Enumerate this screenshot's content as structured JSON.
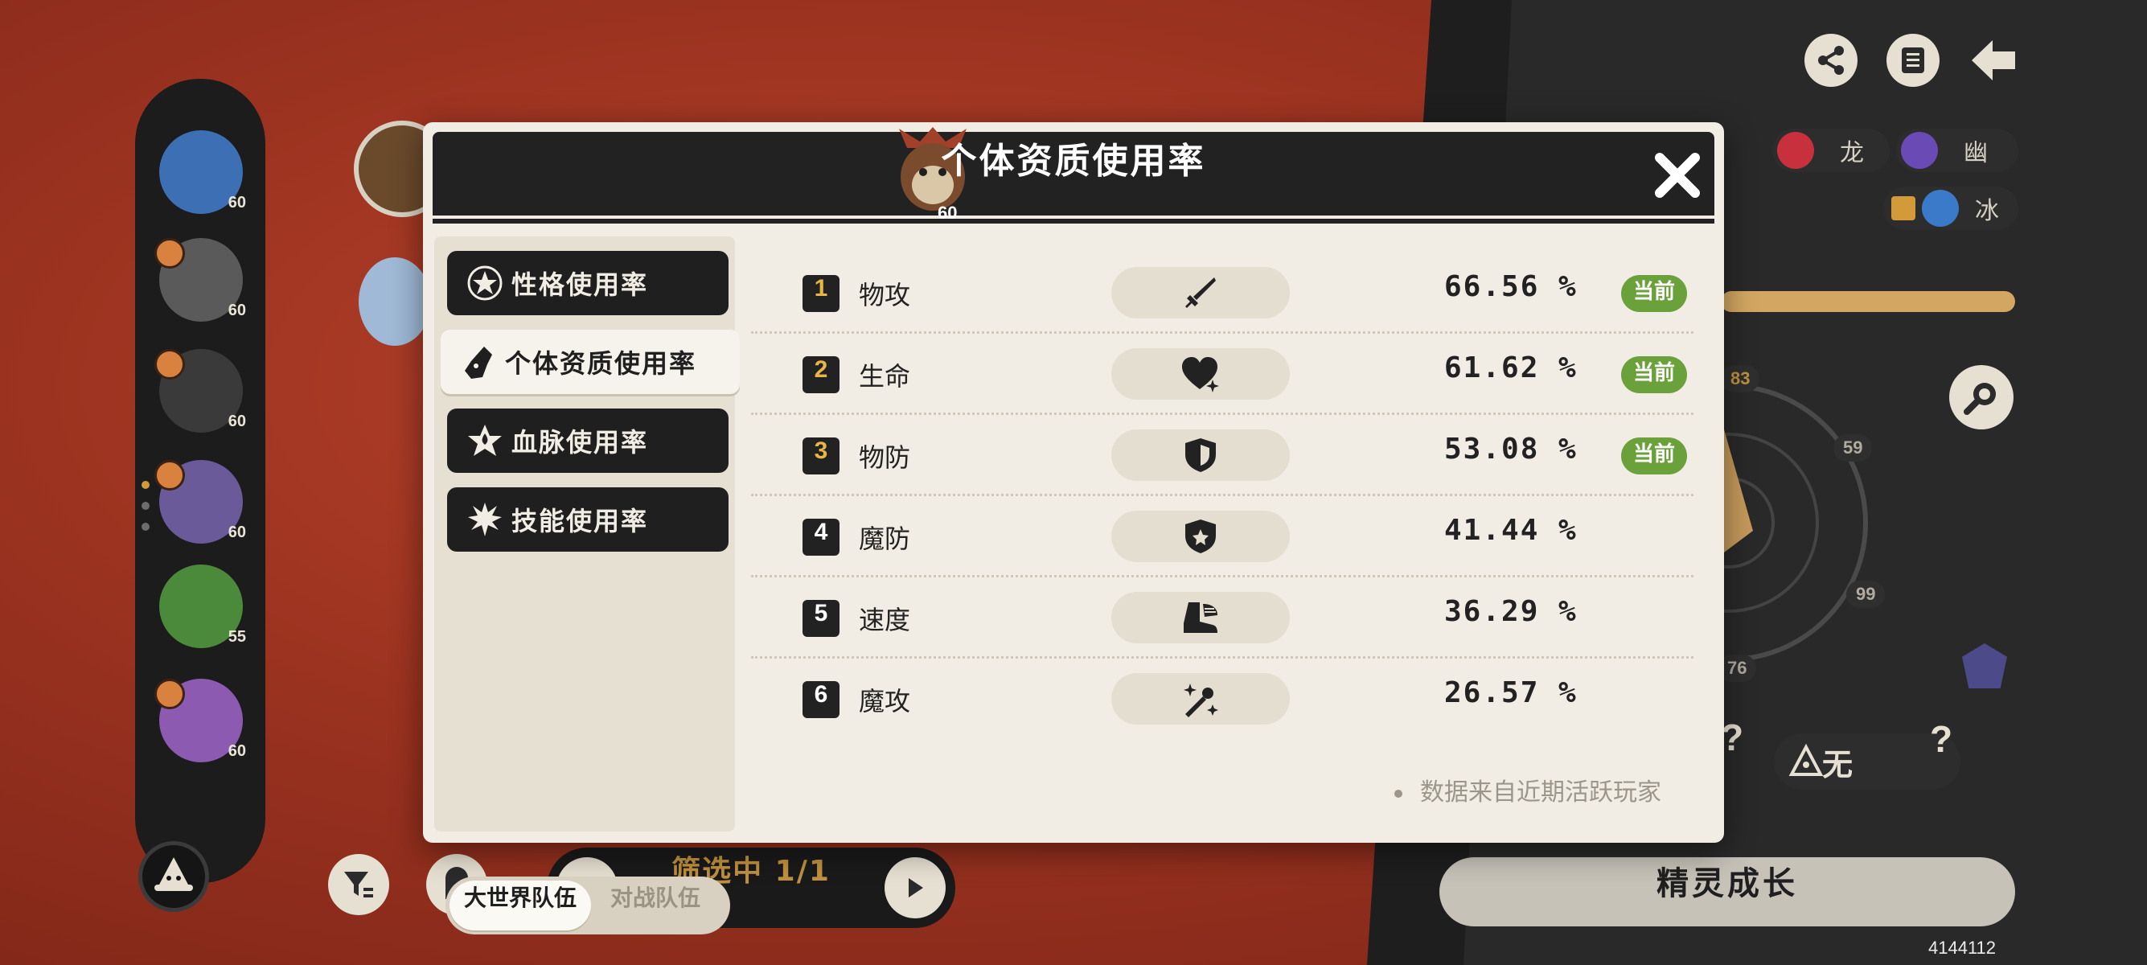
{
  "roster": [
    {
      "level": "60",
      "badge": false,
      "color": "#3d6fb5"
    },
    {
      "level": "60",
      "badge": true,
      "color": "#5a5a5a"
    },
    {
      "level": "60",
      "badge": true,
      "color": "#3a3a3a"
    },
    {
      "level": "60",
      "badge": true,
      "color": "#6a5a9a"
    },
    {
      "level": "55",
      "badge": false,
      "color": "#4b8a3a"
    },
    {
      "level": "60",
      "badge": true,
      "color": "#8c5ab0"
    }
  ],
  "filter": {
    "label": "筛选中 1/1"
  },
  "types": [
    {
      "label": "龙",
      "color": "#c8303e"
    },
    {
      "label": "幽",
      "color": "#6a4ab4"
    },
    {
      "label": "冰",
      "color": "#3a7ac8"
    }
  ],
  "radar": {
    "top_label": "83",
    "speed_label": "59",
    "def_label": "99",
    "bottom_label": "76"
  },
  "nature_chip": {
    "label": "无"
  },
  "grow_button": {
    "label": "精灵成长"
  },
  "uid": "4144112",
  "modal": {
    "title": "个体资质使用率",
    "monster_level": "60",
    "menu": [
      {
        "label": "性格使用率",
        "icon": "star-badge-icon",
        "active": false
      },
      {
        "label": "个体资质使用率",
        "icon": "monster-head-icon",
        "active": true
      },
      {
        "label": "血脉使用率",
        "icon": "blood-star-icon",
        "active": false
      },
      {
        "label": "技能使用率",
        "icon": "skill-burst-icon",
        "active": false
      }
    ],
    "team_toggle": {
      "world": "大世界队伍",
      "battle": "对战队伍",
      "selected": "world"
    },
    "rows": [
      {
        "rank": "1",
        "name": "物攻",
        "icon": "sword-icon",
        "pct": "66.56 %",
        "current": "当前"
      },
      {
        "rank": "2",
        "name": "生命",
        "icon": "heart-icon",
        "pct": "61.62 %",
        "current": "当前"
      },
      {
        "rank": "3",
        "name": "物防",
        "icon": "shield-icon",
        "pct": "53.08 %",
        "current": "当前"
      },
      {
        "rank": "4",
        "name": "魔防",
        "icon": "magic-shield-icon",
        "pct": "41.44 %",
        "current": ""
      },
      {
        "rank": "5",
        "name": "速度",
        "icon": "winged-boot-icon",
        "pct": "36.29 %",
        "current": ""
      },
      {
        "rank": "6",
        "name": "魔攻",
        "icon": "magic-wand-icon",
        "pct": "26.57 %",
        "current": ""
      }
    ],
    "footnote": "数据来自近期活跃玩家"
  }
}
